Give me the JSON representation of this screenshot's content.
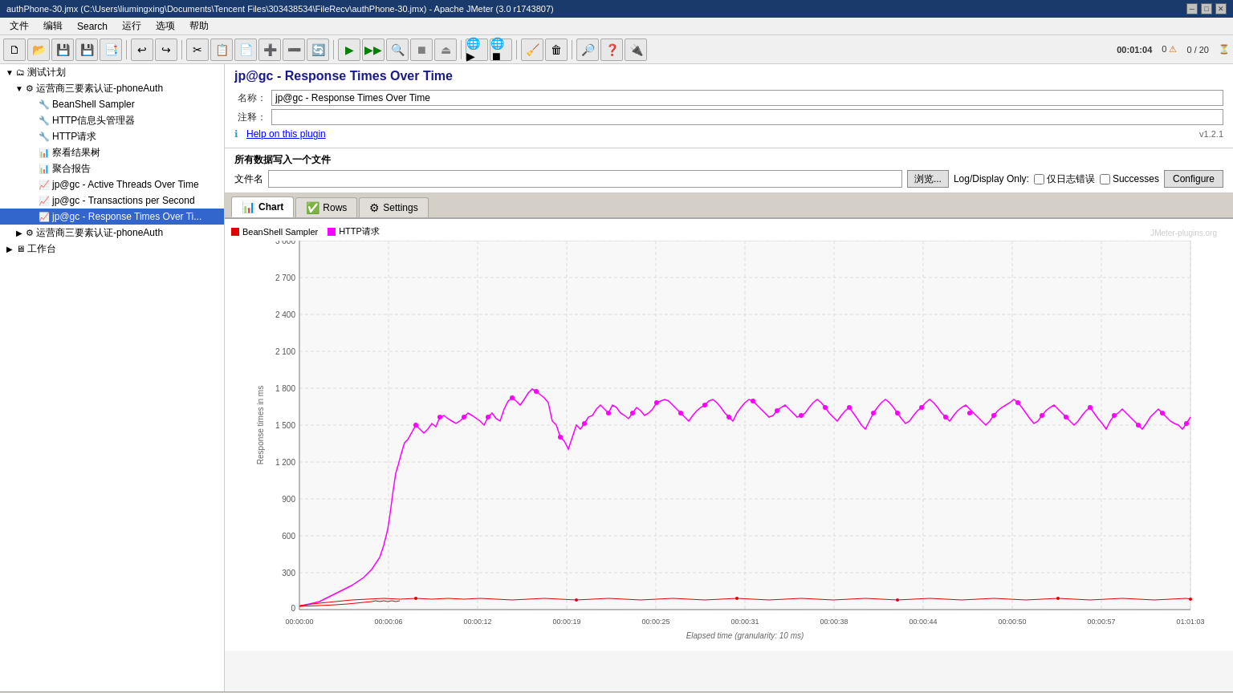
{
  "titleBar": {
    "text": "authPhone-30.jmx (C:\\Users\\liumingxing\\Documents\\Tencent Files\\303438534\\FileRecv\\authPhone-30.jmx) - Apache JMeter (3.0 r1743807)"
  },
  "menuBar": {
    "items": [
      "文件",
      "编辑",
      "Search",
      "运行",
      "选项",
      "帮助"
    ]
  },
  "toolbar": {
    "status": {
      "time": "00:01:04",
      "warnings": "0",
      "progress": "0 / 20"
    }
  },
  "sidebar": {
    "items": [
      {
        "id": "test-plan",
        "label": "测试计划",
        "indent": 0,
        "icon": "🗂",
        "expand": "▼"
      },
      {
        "id": "auth-group1",
        "label": "运营商三要素认证-phoneAuth",
        "indent": 1,
        "icon": "⚙",
        "expand": "▼"
      },
      {
        "id": "beanshell",
        "label": "BeanShell Sampler",
        "indent": 2,
        "icon": "🔧",
        "expand": ""
      },
      {
        "id": "http-mgr",
        "label": "HTTP信息头管理器",
        "indent": 2,
        "icon": "🔧",
        "expand": ""
      },
      {
        "id": "http-req",
        "label": "HTTP请求",
        "indent": 2,
        "icon": "🔧",
        "expand": ""
      },
      {
        "id": "view-results",
        "label": "察看结果树",
        "indent": 2,
        "icon": "📊",
        "expand": ""
      },
      {
        "id": "summary",
        "label": "聚合报告",
        "indent": 2,
        "icon": "📊",
        "expand": ""
      },
      {
        "id": "active-threads",
        "label": "jp@gc - Active Threads Over Time",
        "indent": 2,
        "icon": "📈",
        "expand": ""
      },
      {
        "id": "transactions",
        "label": "jp@gc - Transactions per Second",
        "indent": 2,
        "icon": "📈",
        "expand": ""
      },
      {
        "id": "response-times",
        "label": "jp@gc - Response Times Over Ti...",
        "indent": 2,
        "icon": "📈",
        "expand": "",
        "selected": true
      },
      {
        "id": "auth-group2",
        "label": "运营商三要素认证-phoneAuth",
        "indent": 1,
        "icon": "⚙",
        "expand": "▶"
      },
      {
        "id": "workbench",
        "label": "工作台",
        "indent": 0,
        "icon": "🖥",
        "expand": "▶"
      }
    ]
  },
  "panel": {
    "title": "jp@gc - Response Times Over Time",
    "nameLabel": "名称：",
    "nameValue": "jp@gc - Response Times Over Time",
    "commentLabel": "注释：",
    "commentValue": "",
    "helpText": "Help on this plugin",
    "version": "v1.2.1",
    "fileSection": {
      "title": "所有数据写入一个文件",
      "fileLabel": "文件名",
      "fileValue": "",
      "browseLabel": "浏览...",
      "logDisplayLabel": "Log/Display Only:",
      "logErrLabel": "仅日志错误",
      "successLabel": "Successes",
      "configureLabel": "Configure"
    }
  },
  "tabs": [
    {
      "id": "chart",
      "label": "Chart",
      "icon": "📊",
      "active": true
    },
    {
      "id": "rows",
      "label": "Rows",
      "icon": "✅",
      "active": false
    },
    {
      "id": "settings",
      "label": "Settings",
      "icon": "⚙",
      "active": false
    }
  ],
  "chart": {
    "watermark": "JMeter-plugins.org",
    "yLabel": "Response times in ms",
    "xLabel": "Elapsed time (granularity: 10 ms)",
    "yAxis": [
      "3 000",
      "2 700",
      "2 400",
      "2 100",
      "1 800",
      "1 500",
      "1 200",
      "900",
      "600",
      "300",
      "0"
    ],
    "xAxis": [
      "00:00:00",
      "00:00:06",
      "00:00:12",
      "00:00:19",
      "00:00:25",
      "00:00:31",
      "00:00:38",
      "00:00:44",
      "00:00:50",
      "00:00:57",
      "01:01:03"
    ],
    "legend": [
      {
        "id": "beanshell",
        "label": "BeanShell Sampler",
        "color": "#e00000"
      },
      {
        "id": "http",
        "label": "HTTP请求",
        "color": "#ff00ff"
      }
    ]
  }
}
